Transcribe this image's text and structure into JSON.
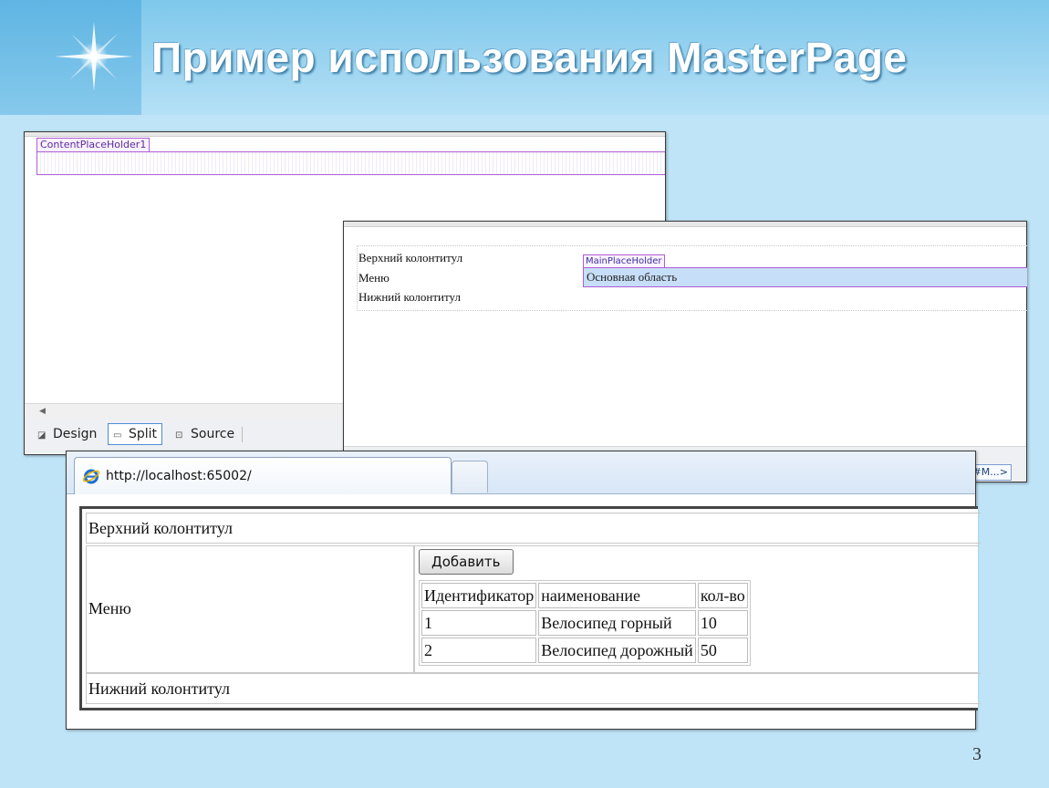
{
  "slide": {
    "title": "Пример использования MasterPage",
    "page_number": "3"
  },
  "designer_content": {
    "placeholder_label": "ContentPlaceHolder1",
    "view_tabs": [
      "Design",
      "Split",
      "Source"
    ]
  },
  "designer_master": {
    "rows": [
      "Верхний колонтитул",
      "Меню",
      "Нижний колонтитул"
    ],
    "placeholder_label": "MainPlaceHolder",
    "placeholder_content": "Основная область",
    "breadcrumb": "#M...>"
  },
  "browser": {
    "url": "http://localhost:65002/",
    "page": {
      "header": "Верхний колонтитул",
      "menu": "Меню",
      "footer": "Нижний колонтитул",
      "add_button": "Добавить",
      "table": {
        "columns": [
          "Идентификатор",
          "наименование",
          "кол-во"
        ],
        "rows": [
          [
            "1",
            "Велосипед горный",
            "10"
          ],
          [
            "2",
            "Велосипед дорожный",
            "50"
          ]
        ]
      }
    }
  }
}
